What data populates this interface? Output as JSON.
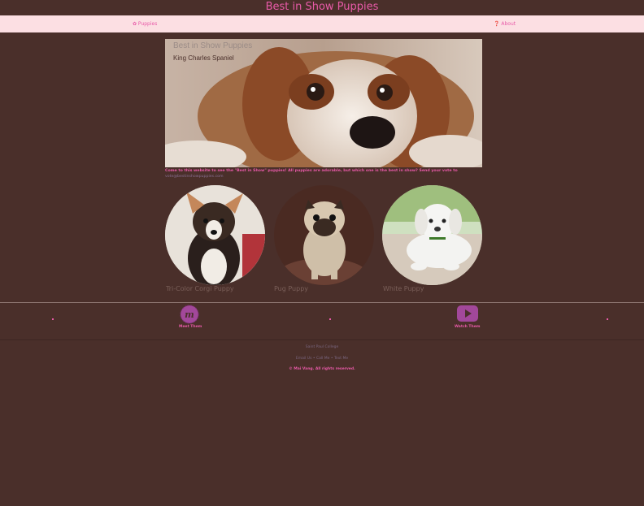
{
  "header": {
    "title": "Best in Show Puppies"
  },
  "nav": {
    "puppies": "✿ Puppies",
    "about": "❓ About"
  },
  "hero": {
    "title": "Best in Show Puppies",
    "subtitle": "King Charles Spaniel"
  },
  "intro": {
    "text": "Come to this website to see the \"Best in Show\" puppies! All puppies are adorable, but which one is the best in show? Send your vote to",
    "email": "vote@bestinshowpuppies.com"
  },
  "puppies": [
    {
      "name": "Tri-Color Corgi Puppy"
    },
    {
      "name": "Pug Puppy"
    },
    {
      "name": "White Puppy"
    }
  ],
  "footer": {
    "meet": "Meet Them",
    "watch": "Watch Them",
    "school": "Saint Paul College",
    "links": "Email Us • Call Me • Text Me",
    "copyright": "© Mai Vang. All rights reserved."
  },
  "colors": {
    "background": "#4a2f2a",
    "accent": "#e85aa8",
    "navbar": "#fcdfe3",
    "icon": "#a2489a"
  }
}
